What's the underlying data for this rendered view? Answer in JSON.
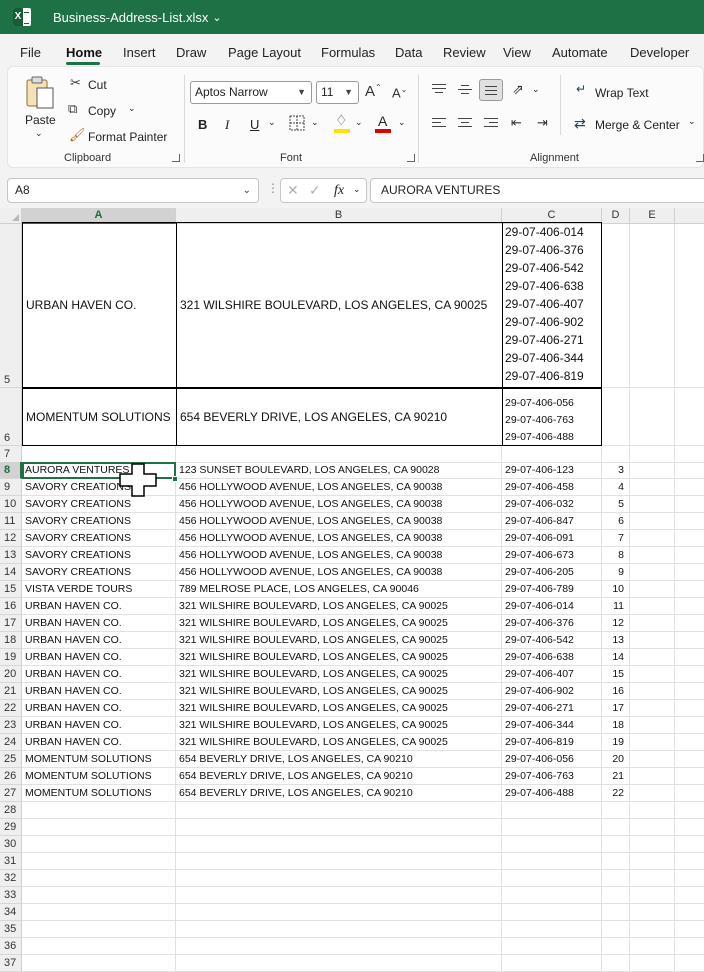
{
  "window": {
    "filename": "Business-Address-List.xlsx"
  },
  "menu": {
    "tabs": [
      "File",
      "Home",
      "Insert",
      "Draw",
      "Page Layout",
      "Formulas",
      "Data",
      "Review",
      "View",
      "Automate",
      "Developer"
    ],
    "active": "Home"
  },
  "ribbon": {
    "clipboard": {
      "paste": "Paste",
      "cut": "Cut",
      "copy": "Copy",
      "format_painter": "Format Painter",
      "label": "Clipboard"
    },
    "font": {
      "name": "Aptos Narrow",
      "size": "11",
      "bold": "B",
      "italic": "I",
      "underline": "U",
      "label": "Font"
    },
    "alignment": {
      "wrap_text": "Wrap Text",
      "merge_center": "Merge & Center",
      "label": "Alignment"
    }
  },
  "formula_bar": {
    "name_box": "A8",
    "fx": "fx",
    "value": "AURORA VENTURES"
  },
  "columns": [
    "A",
    "B",
    "C",
    "D",
    "E"
  ],
  "selected_column": "A",
  "selected_row": "8",
  "row_numbers": [
    "5",
    "6",
    "7",
    "8",
    "9",
    "10",
    "11",
    "12",
    "13",
    "14",
    "15",
    "16",
    "17",
    "18",
    "19",
    "20",
    "21",
    "22",
    "23",
    "24",
    "25",
    "26",
    "27",
    "28",
    "29",
    "30",
    "31",
    "32",
    "33",
    "34",
    "35",
    "36",
    "37"
  ],
  "row5": {
    "name": "URBAN HAVEN CO.",
    "address": "321 WILSHIRE BOULEVARD, LOS ANGELES, CA 90025",
    "apns": [
      "29-07-406-014",
      "29-07-406-376",
      "29-07-406-542",
      "29-07-406-638",
      "29-07-406-407",
      "29-07-406-902",
      "29-07-406-271",
      "29-07-406-344",
      "29-07-406-819"
    ]
  },
  "row6": {
    "name": "MOMENTUM SOLUTIONS",
    "address": "654 BEVERLY DRIVE, LOS ANGELES, CA 90210",
    "apns": [
      "29-07-406-056",
      "29-07-406-763",
      "29-07-406-488"
    ]
  },
  "rows": [
    {
      "r": "8",
      "name": "AURORA VENTURES",
      "address": "123 SUNSET BOULEVARD, LOS ANGELES, CA 90028",
      "apn": "29-07-406-123",
      "d": "3"
    },
    {
      "r": "9",
      "name": "SAVORY CREATIONS",
      "address": "456 HOLLYWOOD AVENUE, LOS ANGELES, CA 90038",
      "apn": "29-07-406-458",
      "d": "4"
    },
    {
      "r": "10",
      "name": "SAVORY CREATIONS",
      "address": "456 HOLLYWOOD AVENUE, LOS ANGELES, CA 90038",
      "apn": "29-07-406-032",
      "d": "5"
    },
    {
      "r": "11",
      "name": "SAVORY CREATIONS",
      "address": "456 HOLLYWOOD AVENUE, LOS ANGELES, CA 90038",
      "apn": "29-07-406-847",
      "d": "6"
    },
    {
      "r": "12",
      "name": "SAVORY CREATIONS",
      "address": "456 HOLLYWOOD AVENUE, LOS ANGELES, CA 90038",
      "apn": "29-07-406-091",
      "d": "7"
    },
    {
      "r": "13",
      "name": "SAVORY CREATIONS",
      "address": "456 HOLLYWOOD AVENUE, LOS ANGELES, CA 90038",
      "apn": "29-07-406-673",
      "d": "8"
    },
    {
      "r": "14",
      "name": "SAVORY CREATIONS",
      "address": "456 HOLLYWOOD AVENUE, LOS ANGELES, CA 90038",
      "apn": "29-07-406-205",
      "d": "9"
    },
    {
      "r": "15",
      "name": "VISTA VERDE TOURS",
      "address": "789 MELROSE PLACE, LOS ANGELES, CA 90046",
      "apn": "29-07-406-789",
      "d": "10"
    },
    {
      "r": "16",
      "name": "URBAN HAVEN CO.",
      "address": "321 WILSHIRE BOULEVARD, LOS ANGELES, CA 90025",
      "apn": "29-07-406-014",
      "d": "11"
    },
    {
      "r": "17",
      "name": "URBAN HAVEN CO.",
      "address": "321 WILSHIRE BOULEVARD, LOS ANGELES, CA 90025",
      "apn": "29-07-406-376",
      "d": "12"
    },
    {
      "r": "18",
      "name": "URBAN HAVEN CO.",
      "address": "321 WILSHIRE BOULEVARD, LOS ANGELES, CA 90025",
      "apn": "29-07-406-542",
      "d": "13"
    },
    {
      "r": "19",
      "name": "URBAN HAVEN CO.",
      "address": "321 WILSHIRE BOULEVARD, LOS ANGELES, CA 90025",
      "apn": "29-07-406-638",
      "d": "14"
    },
    {
      "r": "20",
      "name": "URBAN HAVEN CO.",
      "address": "321 WILSHIRE BOULEVARD, LOS ANGELES, CA 90025",
      "apn": "29-07-406-407",
      "d": "15"
    },
    {
      "r": "21",
      "name": "URBAN HAVEN CO.",
      "address": "321 WILSHIRE BOULEVARD, LOS ANGELES, CA 90025",
      "apn": "29-07-406-902",
      "d": "16"
    },
    {
      "r": "22",
      "name": "URBAN HAVEN CO.",
      "address": "321 WILSHIRE BOULEVARD, LOS ANGELES, CA 90025",
      "apn": "29-07-406-271",
      "d": "17"
    },
    {
      "r": "23",
      "name": "URBAN HAVEN CO.",
      "address": "321 WILSHIRE BOULEVARD, LOS ANGELES, CA 90025",
      "apn": "29-07-406-344",
      "d": "18"
    },
    {
      "r": "24",
      "name": "URBAN HAVEN CO.",
      "address": "321 WILSHIRE BOULEVARD, LOS ANGELES, CA 90025",
      "apn": "29-07-406-819",
      "d": "19"
    },
    {
      "r": "25",
      "name": "MOMENTUM SOLUTIONS",
      "address": "654 BEVERLY DRIVE, LOS ANGELES, CA 90210",
      "apn": "29-07-406-056",
      "d": "20"
    },
    {
      "r": "26",
      "name": "MOMENTUM SOLUTIONS",
      "address": "654 BEVERLY DRIVE, LOS ANGELES, CA 90210",
      "apn": "29-07-406-763",
      "d": "21"
    },
    {
      "r": "27",
      "name": "MOMENTUM SOLUTIONS",
      "address": "654 BEVERLY DRIVE, LOS ANGELES, CA 90210",
      "apn": "29-07-406-488",
      "d": "22"
    }
  ],
  "colors": {
    "title_bar": "#1e7145",
    "selection": "#1e7145",
    "font_color_bar": "#e00000",
    "highlight_bar": "#ffe000"
  }
}
